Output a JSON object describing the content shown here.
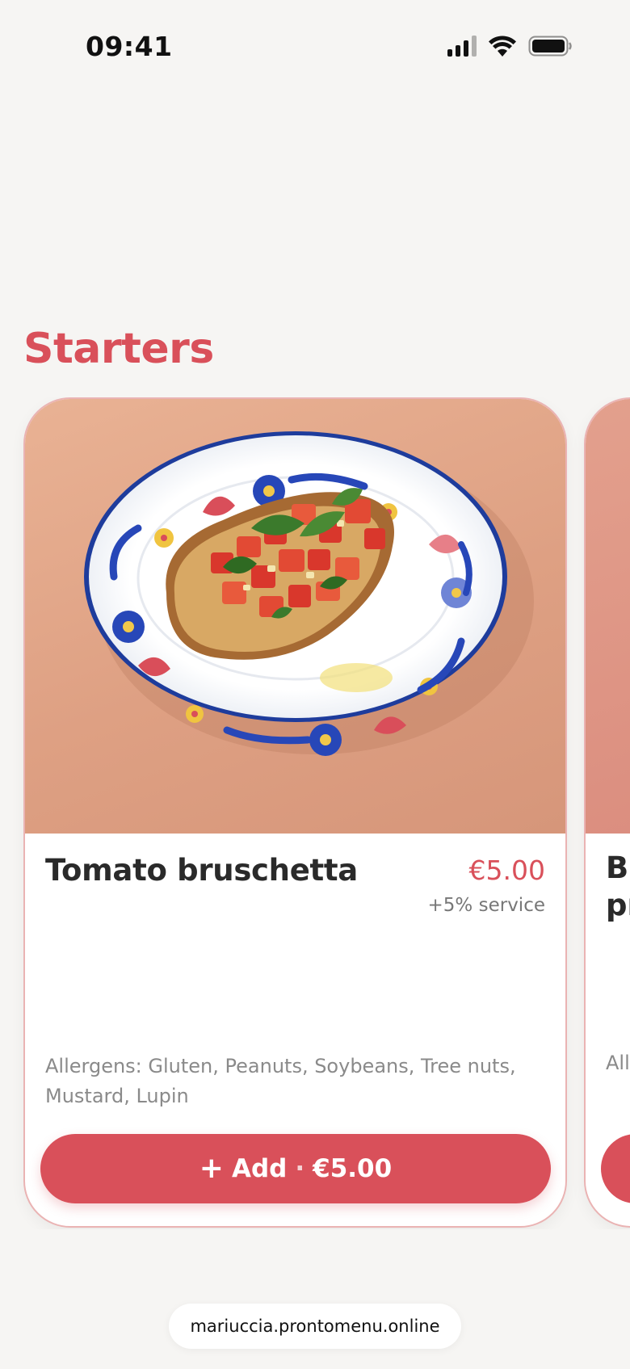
{
  "status_bar": {
    "time": "09:41"
  },
  "section": {
    "title": "Starters"
  },
  "cards": [
    {
      "name": "Tomato bruschetta",
      "price": "€5.00",
      "service_note": "+5% service",
      "allergens": "Allergens: Gluten, Peanuts, Soybeans, Tree nuts, Mustard, Lupin",
      "add_button": {
        "icon": "+",
        "label": "Add",
        "separator": "·",
        "price": "€5.00"
      }
    },
    {
      "name_partial": "Bu\npr",
      "allergens_partial": "All"
    }
  ],
  "browser": {
    "url": "mariuccia.prontomenu.online"
  },
  "colors": {
    "accent": "#d9505a",
    "background": "#f6f5f3",
    "card_border": "#eab3b3"
  }
}
